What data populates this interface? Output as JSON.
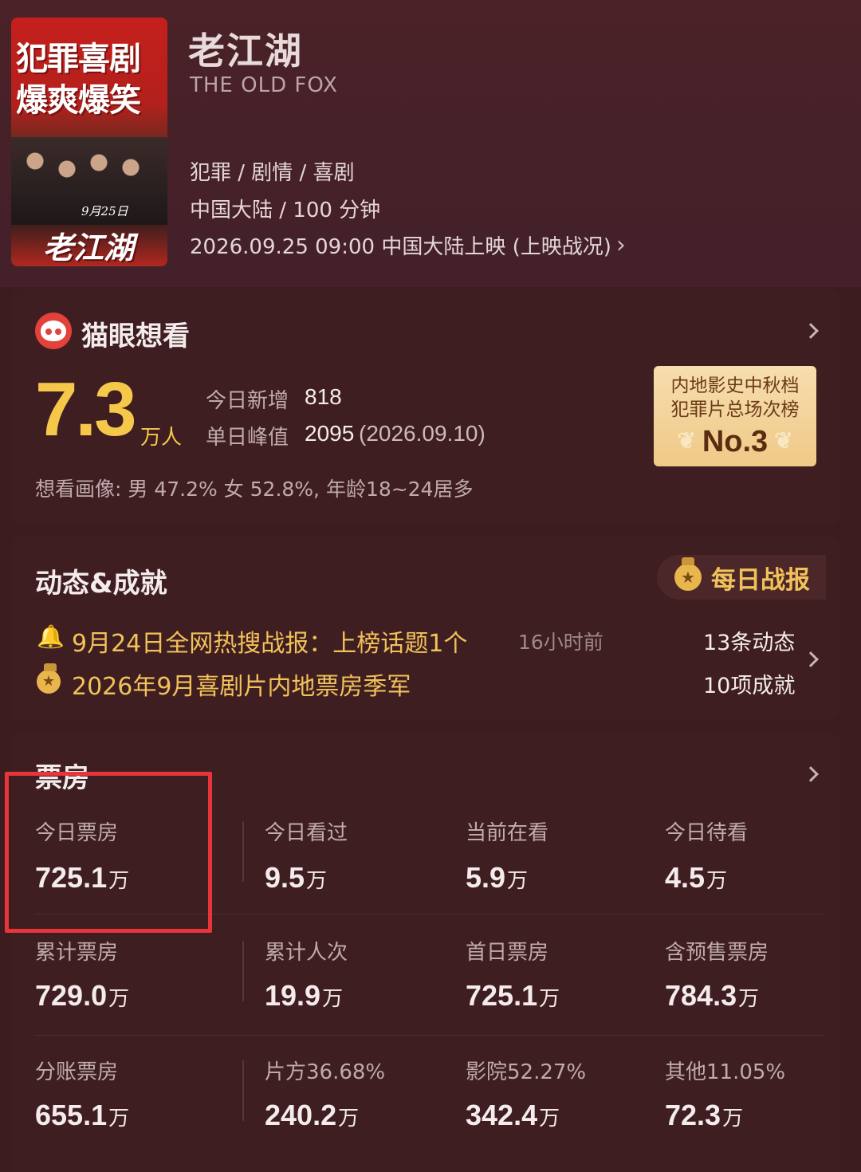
{
  "movie": {
    "title_cn": "老江湖",
    "title_en": "THE OLD FOX",
    "genre": "犯罪 / 剧情 / 喜剧",
    "region_duration": "中国大陆 / 100 分钟",
    "release": "2026.09.25 09:00 中国大陆上映 (上映战况)",
    "poster": {
      "headline_line1": "犯罪喜剧",
      "headline_line2": "爆爽爆笑",
      "date": "9月25日",
      "logo": "老江湖"
    }
  },
  "want": {
    "title": "猫眼想看",
    "total": "7.3",
    "total_unit": "万人",
    "today_label": "今日新增",
    "today_value": "818",
    "peak_label": "单日峰值",
    "peak_value": "2095",
    "peak_date": "(2026.09.10)",
    "rank_line1": "内地影史中秋档",
    "rank_line2": "犯罪片总场次榜",
    "rank_value": "No.3",
    "portrait": "想看画像: 男 47.2%  女 52.8%,  年龄18~24居多"
  },
  "news": {
    "title": "动态&成就",
    "daily_label": "每日战报",
    "item1_text": "9月24日全网热搜战报：上榜话题1个",
    "item1_time": "16小时前",
    "item2_text": "2026年9月喜剧片内地票房季军",
    "count1": "13条动态",
    "count2": "10项成就"
  },
  "boxoffice": {
    "title": "票房",
    "cells": [
      {
        "label": "今日票房",
        "value": "725.1",
        "unit": "万"
      },
      {
        "label": "今日看过",
        "value": "9.5",
        "unit": "万"
      },
      {
        "label": "当前在看",
        "value": "5.9",
        "unit": "万"
      },
      {
        "label": "今日待看",
        "value": "4.5",
        "unit": "万"
      },
      {
        "label": "累计票房",
        "value": "729.0",
        "unit": "万"
      },
      {
        "label": "累计人次",
        "value": "19.9",
        "unit": "万"
      },
      {
        "label": "首日票房",
        "value": "725.1",
        "unit": "万"
      },
      {
        "label": "含预售票房",
        "value": "784.3",
        "unit": "万"
      },
      {
        "label": "分账票房",
        "value": "655.1",
        "unit": "万"
      },
      {
        "label": "片方36.68%",
        "value": "240.2",
        "unit": "万"
      },
      {
        "label": "影院52.27%",
        "value": "342.4",
        "unit": "万"
      },
      {
        "label": "其他11.05%",
        "value": "72.3",
        "unit": "万"
      }
    ]
  },
  "colors": {
    "background": "#3c1c1f",
    "card": "#3f1e21",
    "accent_gold": "#f5c84a",
    "highlight_red": "#e8343b"
  }
}
